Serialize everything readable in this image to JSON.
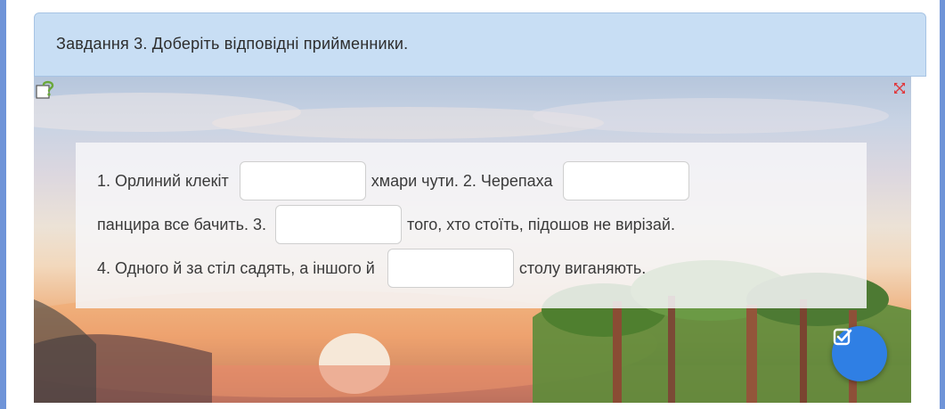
{
  "task": {
    "title": "Завдання 3. Доберіть відповідні прийменники."
  },
  "icons": {
    "help": "help-icon",
    "fullscreen": "fullscreen-icon",
    "check": "check-icon"
  },
  "exercise": {
    "line1": {
      "part1": "1. Орлиний клекіт",
      "part2": "хмари чути. 2. Черепаха"
    },
    "line2": {
      "part1": "панцира все бачить. 3.",
      "part2": "того, хто стоїть, підошов не вирізай."
    },
    "line3": {
      "part1": "4. Одного й за стіл садять, а іншого й",
      "part2": "столу виганяють."
    },
    "gaps": [
      "",
      "",
      "",
      ""
    ]
  },
  "colors": {
    "accent": "#2f7fe4",
    "header_bg": "#c8def4",
    "side_bar": "#6f94d8"
  }
}
